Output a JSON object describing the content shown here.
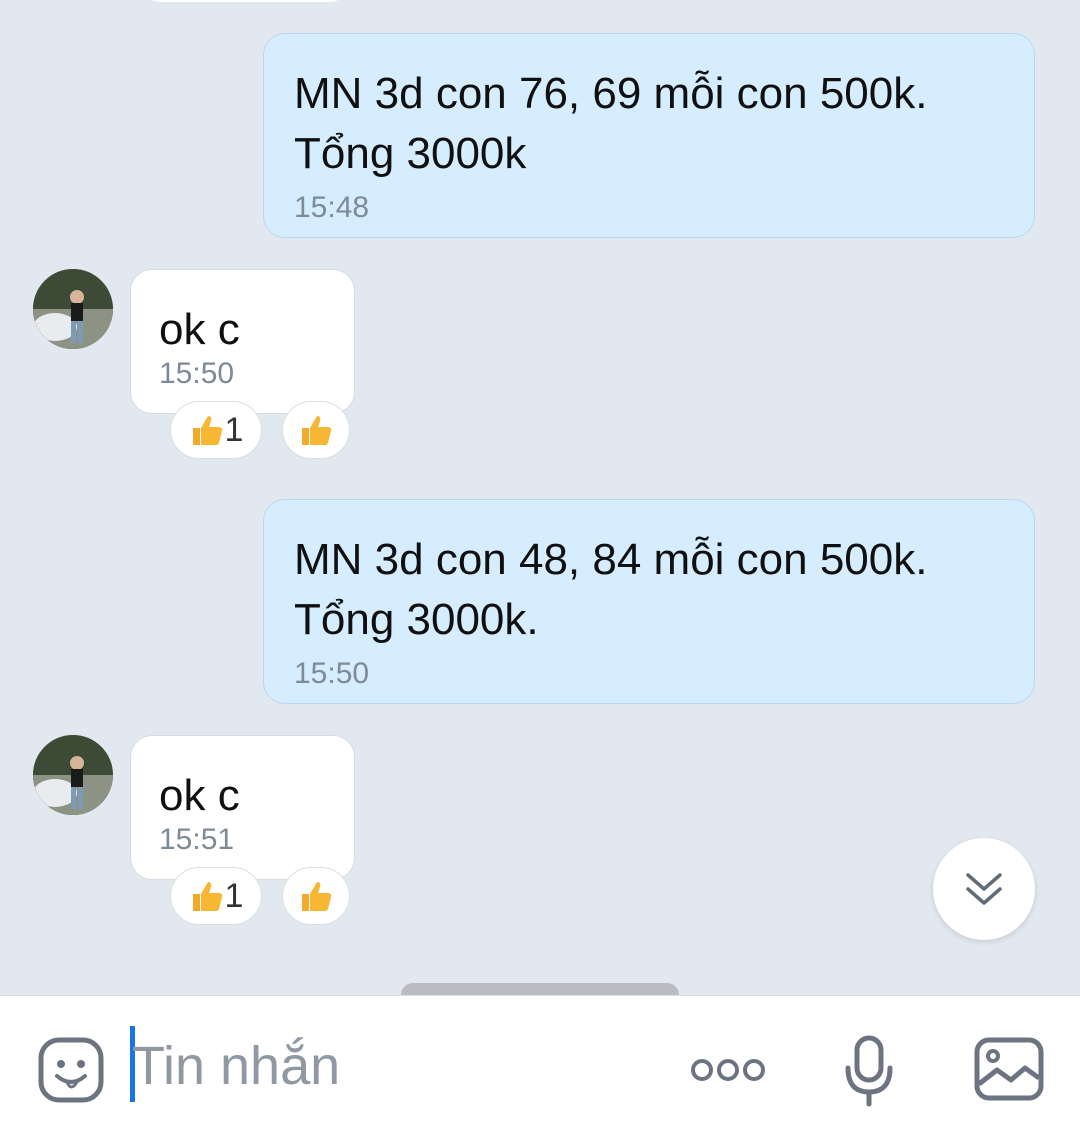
{
  "messages": [
    {
      "direction": "out",
      "text_line1": "MN 3d con 76, 69 mỗi con 500k.",
      "text_line2": "Tổng 3000k",
      "time": "15:48"
    },
    {
      "direction": "in",
      "text": "ok c",
      "time": "15:50",
      "reaction_count": "1"
    },
    {
      "direction": "out",
      "text_line1": "MN 3d con 48, 84 mỗi con 500k.",
      "text_line2": "Tổng 3000k.",
      "time": "15:50"
    },
    {
      "direction": "in",
      "text": "ok c",
      "time": "15:51",
      "reaction_count": "1"
    }
  ],
  "composer": {
    "placeholder": "Tin nhắn",
    "icons": [
      "sticker-icon",
      "more-options-icon",
      "microphone-icon",
      "image-icon"
    ]
  },
  "colors": {
    "outgoing_bubble": "#d5edff",
    "incoming_bubble": "#ffffff",
    "background": "#e2e8f0",
    "caret": "#1a73e8"
  }
}
